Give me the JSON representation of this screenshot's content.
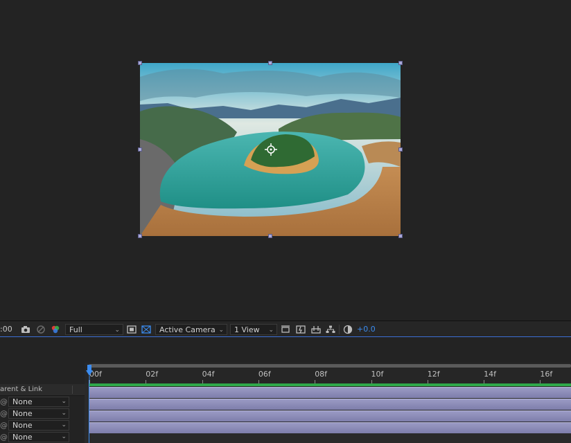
{
  "viewer": {
    "layer_image": "river-bend-landscape-photo"
  },
  "toolbar": {
    "timecode": ":00",
    "resolution": "Full",
    "camera": "Active Camera",
    "views": "1 View",
    "exposure": "+0.0",
    "accent": "#3b8cf0",
    "icons": [
      "camera-icon",
      "show-snapshot-icon",
      "color-channels-icon",
      "region-of-interest-icon",
      "transparency-grid-icon",
      "reset-view-icon",
      "fast-preview-icon",
      "flowchart-icon",
      "reset-exposure-icon"
    ]
  },
  "timeline": {
    "column_header": "arent & Link",
    "ruler_labels": [
      "00f",
      "02f",
      "04f",
      "06f",
      "08f",
      "10f",
      "12f",
      "14f",
      "16f"
    ],
    "layers": [
      {
        "parent": "None"
      },
      {
        "parent": "None"
      },
      {
        "parent": "None"
      },
      {
        "parent": "None"
      }
    ],
    "bar_color": "#8f8fbd",
    "header_icons": [
      "shy-layers-icon",
      "frame-blending-icon",
      "motion-blur-icon",
      "graph-editor-icon"
    ]
  }
}
